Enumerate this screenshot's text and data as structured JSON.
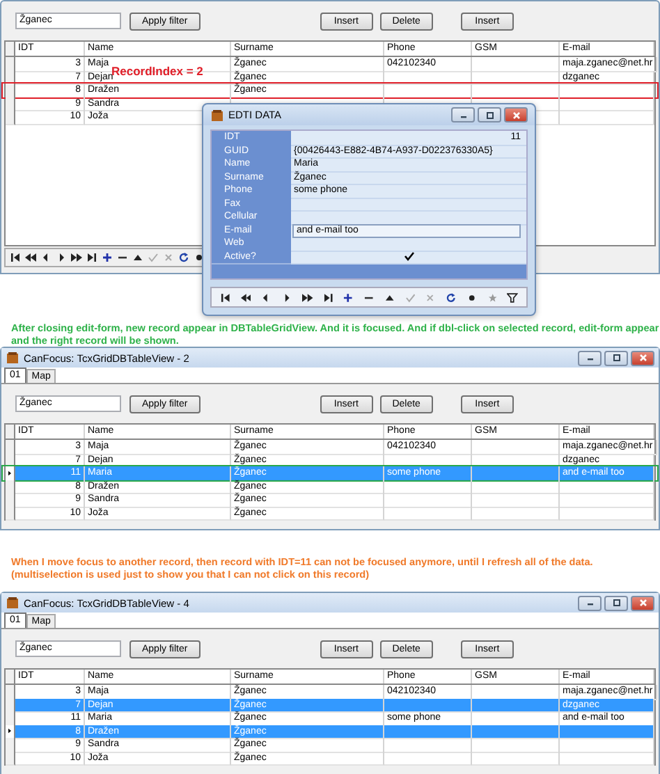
{
  "panel": {
    "toolbar": {
      "filter_field": {
        "value": "Žganec"
      },
      "filter_button": "Apply filter",
      "actions": [
        "Insert",
        "Delete"
      ],
      "extra_button": "Insert"
    },
    "grid": {
      "columns": [
        "IDT",
        "Name",
        "Surname",
        "Phone",
        "GSM",
        "E-mail"
      ],
      "rows": [
        {
          "idt": "3",
          "name": "Maja",
          "surname": "Žganec",
          "phone": "042102340",
          "email": "maja.zganec@net.hr",
          "selected": false,
          "focused": false,
          "outlined": false
        },
        {
          "idt": "7",
          "name": "Dejan",
          "surname": "Žganec",
          "email": "dzganec",
          "selected": false,
          "focused": false,
          "outlined": false
        },
        {
          "idt": "8",
          "name": "Dražen",
          "surname": "Žganec",
          "selected": false,
          "focused": false,
          "outlined": true
        },
        {
          "idt": "9",
          "name": "Sandra",
          "selected": false,
          "focused": false,
          "outlined": false
        },
        {
          "idt": "10",
          "name": "Joža",
          "selected": false,
          "focused": false,
          "outlined": false
        }
      ]
    },
    "annotation": {
      "label": "RecordIndex = 2",
      "color": "#e0202a"
    },
    "navigator": true
  },
  "dialog": {
    "title": "EDTI DATA",
    "fields": [
      {
        "label": "IDT",
        "value": "11",
        "kind": "number",
        "focused": false
      },
      {
        "label": "GUID",
        "value": "{00426443-E882-4B74-A937-D022376330A5}",
        "kind": "text",
        "focused": false
      },
      {
        "label": "Name",
        "value": "Maria",
        "kind": "text",
        "focused": false
      },
      {
        "label": "Surname",
        "value": "Žganec",
        "kind": "text",
        "focused": false
      },
      {
        "label": "Phone",
        "value": "some phone",
        "kind": "text",
        "focused": false
      },
      {
        "label": "Fax",
        "kind": "text",
        "focused": false
      },
      {
        "label": "Cellular",
        "kind": "text",
        "focused": false
      },
      {
        "label": "E-mail",
        "value": "and e-mail too",
        "kind": "text",
        "focused": true
      },
      {
        "label": "Web",
        "kind": "text",
        "focused": false
      },
      {
        "label": "Active?",
        "kind": "check",
        "checked": true,
        "focused": false
      }
    ]
  },
  "note_1": {
    "lines": [
      "After closing edit-form, new record appear in DBTableGridView. And it is focused. And if dbl-click on selected record, edit-form appear",
      "and the right record will be shown."
    ],
    "color": "#2fb24a"
  },
  "window_2": {
    "title": "CanFocus: TcxGridDBTableView - 2",
    "tabs": [
      {
        "label": "01",
        "selected": true
      },
      {
        "label": "Map",
        "selected": false
      }
    ],
    "toolbar": {
      "filter_field": {
        "value": "Žganec"
      },
      "filter_button": "Apply filter",
      "actions": [
        "Insert",
        "Delete"
      ],
      "extra_button": "Insert"
    },
    "grid": {
      "columns": [
        "IDT",
        "Name",
        "Surname",
        "Phone",
        "GSM",
        "E-mail"
      ],
      "rows": [
        {
          "idt": "3",
          "name": "Maja",
          "surname": "Žganec",
          "phone": "042102340",
          "email": "maja.zganec@net.hr",
          "selected": false,
          "focused": false,
          "outlined": false
        },
        {
          "idt": "7",
          "name": "Dejan",
          "surname": "Žganec",
          "email": "dzganec",
          "selected": false,
          "focused": false,
          "outlined": false
        },
        {
          "idt": "11",
          "name": "Maria",
          "surname": "Žganec",
          "phone": "some phone",
          "email": "and e-mail too",
          "selected": true,
          "focused": true,
          "outlined": true
        },
        {
          "idt": "8",
          "name": "Dražen",
          "surname": "Žganec",
          "selected": false,
          "focused": false,
          "outlined": false
        },
        {
          "idt": "9",
          "name": "Sandra",
          "surname": "Žganec",
          "selected": false,
          "focused": false,
          "outlined": false
        },
        {
          "idt": "10",
          "name": "Joža",
          "surname": "Žganec",
          "selected": false,
          "focused": false,
          "outlined": false
        }
      ]
    },
    "annotation": {
      "color": "#2aa84a"
    }
  },
  "note_2": {
    "lines": [
      "When I move focus to another record, then record with IDT=11 can not be focused anymore, until I refresh all of the data.",
      "(multiselection is used just to show you that I can not click on this record)"
    ],
    "color": "#f07a2a"
  },
  "window_3": {
    "title": "CanFocus: TcxGridDBTableView - 4",
    "tabs": [
      {
        "label": "01",
        "selected": true
      },
      {
        "label": "Map",
        "selected": false
      }
    ],
    "toolbar": {
      "filter_field": {
        "value": "Žganec"
      },
      "filter_button": "Apply filter",
      "actions": [
        "Insert",
        "Delete"
      ],
      "extra_button": "Insert"
    },
    "grid": {
      "columns": [
        "IDT",
        "Name",
        "Surname",
        "Phone",
        "GSM",
        "E-mail"
      ],
      "rows": [
        {
          "idt": "3",
          "name": "Maja",
          "surname": "Žganec",
          "phone": "042102340",
          "email": "maja.zganec@net.hr",
          "selected": false,
          "focused": false
        },
        {
          "idt": "7",
          "name": "Dejan",
          "surname": "Žganec",
          "email": "dzganec",
          "selected": true,
          "focused": false
        },
        {
          "idt": "11",
          "name": "Maria",
          "surname": "Žganec",
          "phone": "some phone",
          "email": "and e-mail too",
          "selected": false,
          "focused": false
        },
        {
          "idt": "8",
          "name": "Dražen",
          "surname": "Žganec",
          "selected": true,
          "focused": true
        },
        {
          "idt": "9",
          "name": "Sandra",
          "surname": "Žganec",
          "selected": false,
          "focused": false
        },
        {
          "idt": "10",
          "name": "Joža",
          "surname": "Žganec",
          "selected": false,
          "focused": false
        }
      ]
    }
  }
}
